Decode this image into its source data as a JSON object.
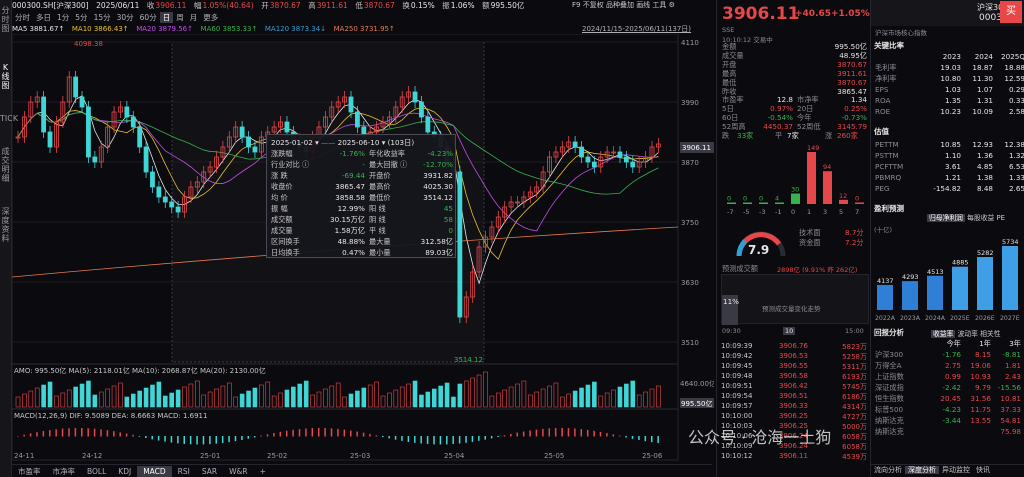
{
  "topbar": {
    "code": "000300.SH[沪深300]",
    "date": "2025/06/11",
    "close_label": "收",
    "close": "3906.11",
    "change_label": "幅",
    "change": "1.05%(40.64)",
    "open_label": "开",
    "open": "3870.67",
    "high_label": "高",
    "high": "3911.61",
    "low_label": "低",
    "low": "3870.67",
    "turnover_label": "换",
    "turnover": "0.15%",
    "amp_label": "振",
    "amp": "1.06%",
    "amount_label": "额",
    "amount": "995.50亿"
  },
  "menu": {
    "f9": "F9",
    "nofq": "不复权",
    "overlay": "品种叠加",
    "draw": "画线",
    "tools": "工具",
    "settings": "⚙",
    "range": "2024/11/15-2025/06/11(137日)"
  },
  "leftnav": [
    "分时图",
    "K线图",
    "TICK",
    "成交明细",
    "深度资料"
  ],
  "timeframes": [
    "分时",
    "多日",
    "1分",
    "5分",
    "15分",
    "30分",
    "60分",
    "日",
    "周",
    "月",
    "更多"
  ],
  "active_tf": "日",
  "ma": [
    {
      "t": "MA5 3881.67↑",
      "c": "#e6e6e6"
    },
    {
      "t": "MA10 3866.43↑",
      "c": "#e5c02e"
    },
    {
      "t": "MA20 3879.56↑",
      "c": "#c04ee6"
    },
    {
      "t": "MA60 3853.33↑",
      "c": "#37b24d"
    },
    {
      "t": "MA120 3873.34↓",
      "c": "#2f9fd6"
    },
    {
      "t": "MA250 3731.95↑",
      "c": "#e67a4e"
    }
  ],
  "price_axis": [
    "4110",
    "3990",
    "3870",
    "3750",
    "3630",
    "3510"
  ],
  "current_price_tag": "3906.11",
  "high_marker": "4098.38",
  "low_marker": "3514.12",
  "tooltip": {
    "from": "2025-01-02",
    "to": "2025-06-10",
    "days": "(103日)",
    "left": [
      [
        "涨跌幅",
        "-1.76%"
      ],
      [
        "行业对比 ⓘ",
        "-"
      ],
      [
        "涨  跌",
        "-69.44"
      ],
      [
        "收盘价",
        "3865.47"
      ],
      [
        "均  价",
        "3858.58"
      ],
      [
        "振  幅",
        "12.99%"
      ],
      [
        "成交额",
        "30.15万亿"
      ],
      [
        "成交量",
        "1.58万亿"
      ],
      [
        "区间换手",
        "48.88%"
      ],
      [
        "日均换手",
        "0.47%"
      ]
    ],
    "right": [
      [
        "年化收益率",
        "-4.23%"
      ],
      [
        "最大回撤 ⓘ",
        "-12.70%"
      ],
      [
        "开盘价",
        "3931.82"
      ],
      [
        "最高价",
        "4025.30"
      ],
      [
        "最低价",
        "3514.12"
      ],
      [
        "阳  线",
        "45"
      ],
      [
        "阴  线",
        "58"
      ],
      [
        "平  线",
        "0"
      ],
      [
        "最大量",
        "312.58亿"
      ],
      [
        "最小量",
        "89.03亿"
      ]
    ]
  },
  "vol": {
    "label": "AMO: 995.50亿 MA(5): 2118.01亿 MA(10): 2068.87亿 MA(20): 2130.00亿",
    "axis_top": "4640.00亿",
    "axis_cur": "995.50亿"
  },
  "macd": {
    "label": "MACD(12,26,9) DIF: 9.5089 DEA: 8.6663 MACD: 1.6911"
  },
  "xaxis": [
    "24-11",
    "24-12",
    "25-01",
    "25-02",
    "25-03",
    "25-04",
    "25-05",
    "25-06"
  ],
  "bottom_tabs": [
    "市盈率",
    "市净率",
    "BOLL",
    "KDJ",
    "MACD",
    "RSI",
    "SAR",
    "W&R",
    "+"
  ],
  "active_bottom": "MACD",
  "quote": {
    "price": "3906.11",
    "chg": "+40.65",
    "pct": "+1.05%",
    "name": "沪深300",
    "code": "000300",
    "market": "SSE",
    "time": "10:10:12",
    "status": "交易中",
    "index_tag": "沪深市场核心指数",
    "buy_btn": "买"
  },
  "quote_kv": [
    [
      "金额",
      "995.50亿"
    ],
    [
      "成交量",
      "48.95亿"
    ],
    [
      "开盘",
      "3870.67"
    ],
    [
      "最高",
      "3911.61"
    ],
    [
      "最低",
      "3870.67"
    ],
    [
      "昨收",
      "3865.47"
    ]
  ],
  "quote_stats": [
    [
      "市盈率",
      "12.8",
      "市净率",
      "1.34"
    ],
    [
      "5日",
      "0.97%",
      "20日",
      "0.25%"
    ],
    [
      "60日",
      "-0.54%",
      "今年",
      "-0.73%"
    ],
    [
      "52周高",
      "4450.37",
      "52周低",
      "3145.79"
    ],
    [
      "跌",
      "33家",
      "平",
      "7家",
      "涨",
      "260家"
    ]
  ],
  "dist": {
    "labels": [
      "-7",
      "-5",
      "-3",
      "-1",
      "0",
      "1",
      "3",
      "5",
      "7"
    ],
    "values": [
      0,
      0,
      0,
      0,
      30,
      149,
      94,
      12,
      0
    ],
    "value_labels": [
      "0",
      "0",
      "0",
      "4",
      "30",
      "149",
      "94",
      "12",
      "0"
    ]
  },
  "gauge": {
    "value": "7.9",
    "tech_label": "技术面",
    "tech": "8.7分",
    "fund_label": "资金面",
    "fund": "7.2分"
  },
  "predict": {
    "label": "预测成交额",
    "value": "2898亿 (9.91% 昨 262亿)",
    "pct": "11%",
    "hint": "预测成交量变化走势",
    "times": [
      "09:30",
      "10",
      "15:00"
    ]
  },
  "ticks": [
    [
      "10:09:39",
      "3906.76",
      "5823万"
    ],
    [
      "10:09:42",
      "3906.53",
      "5258万"
    ],
    [
      "10:09:45",
      "3906.55",
      "5311万"
    ],
    [
      "10:09:48",
      "3906.58",
      "6193万"
    ],
    [
      "10:09:51",
      "3906.42",
      "5745万"
    ],
    [
      "10:09:54",
      "3906.51",
      "6186万"
    ],
    [
      "10:09:57",
      "3906.33",
      "4314万"
    ],
    [
      "10:10:00",
      "3906.25",
      "4727万"
    ],
    [
      "10:10:03",
      "3906.25",
      "5000万"
    ],
    [
      "10:10:06",
      "3906.24",
      "6058万"
    ],
    [
      "10:10:09",
      "3906.24",
      "6058万"
    ],
    [
      "10:10:12",
      "3906.11",
      "4539万"
    ]
  ],
  "ratio": {
    "title": "关键比率",
    "years": [
      "2023",
      "2024",
      "2025Q"
    ],
    "rows": [
      [
        "毛利率",
        "19.03",
        "18.87",
        "18.88"
      ],
      [
        "净利率",
        "10.80",
        "11.30",
        "12.59"
      ],
      [
        "EPS",
        "1.03",
        "1.07",
        "0.29"
      ],
      [
        "ROA",
        "1.35",
        "1.31",
        "0.33"
      ],
      [
        "ROE",
        "10.23",
        "10.09",
        "2.58"
      ]
    ]
  },
  "valuation": {
    "title": "估值",
    "rows": [
      [
        "PETTM",
        "10.85",
        "12.93",
        "12.38"
      ],
      [
        "PSTTM",
        "1.10",
        "1.36",
        "1.32"
      ],
      [
        "PCFTTM",
        "3.61",
        "4.85",
        "6.53"
      ],
      [
        "PBMRQ",
        "1.21",
        "1.38",
        "1.33"
      ],
      [
        "PEG",
        "-154.82",
        "8.48",
        "2.65"
      ]
    ]
  },
  "profit": {
    "title": "盈利预测",
    "unit": "(十亿)",
    "tabs": [
      "归母净利润",
      "每股收益",
      "PE"
    ],
    "years": [
      "2022A",
      "2023A",
      "2024A",
      "2025E",
      "2026E",
      "2027E"
    ],
    "values": [
      4137,
      4293,
      4513,
      4885,
      5282,
      5734
    ],
    "labels": [
      "4137",
      "4293",
      "4513",
      "4885",
      "5282",
      "5734"
    ]
  },
  "review": {
    "title": "回报分析",
    "tabs": [
      "收益率",
      "波动率",
      "相关性"
    ],
    "cols": [
      "今年",
      "1年",
      "3年"
    ],
    "rows": [
      [
        "沪深300",
        "-1.76",
        "8.15",
        "-8.81"
      ],
      [
        "万得全A",
        "2.75",
        "19.06",
        "1.81"
      ],
      [
        "上证指数",
        "0.99",
        "10.93",
        "2.43"
      ],
      [
        "深证成指",
        "-2.42",
        "9.79",
        "-15.56"
      ],
      [
        "恒生指数",
        "20.45",
        "31.56",
        "10.81"
      ],
      [
        "标普500",
        "-4.23",
        "11.75",
        "37.33"
      ],
      [
        "纳斯达克",
        "-3.44",
        "13.55",
        "54.81"
      ],
      [
        "纳斯达克",
        "",
        "",
        "75.98"
      ]
    ]
  },
  "right_bottom_tabs": [
    "流向分析",
    "深度分析",
    "异动监控",
    "快讯"
  ],
  "watermark": "公众号 · 沧海一土狗"
}
